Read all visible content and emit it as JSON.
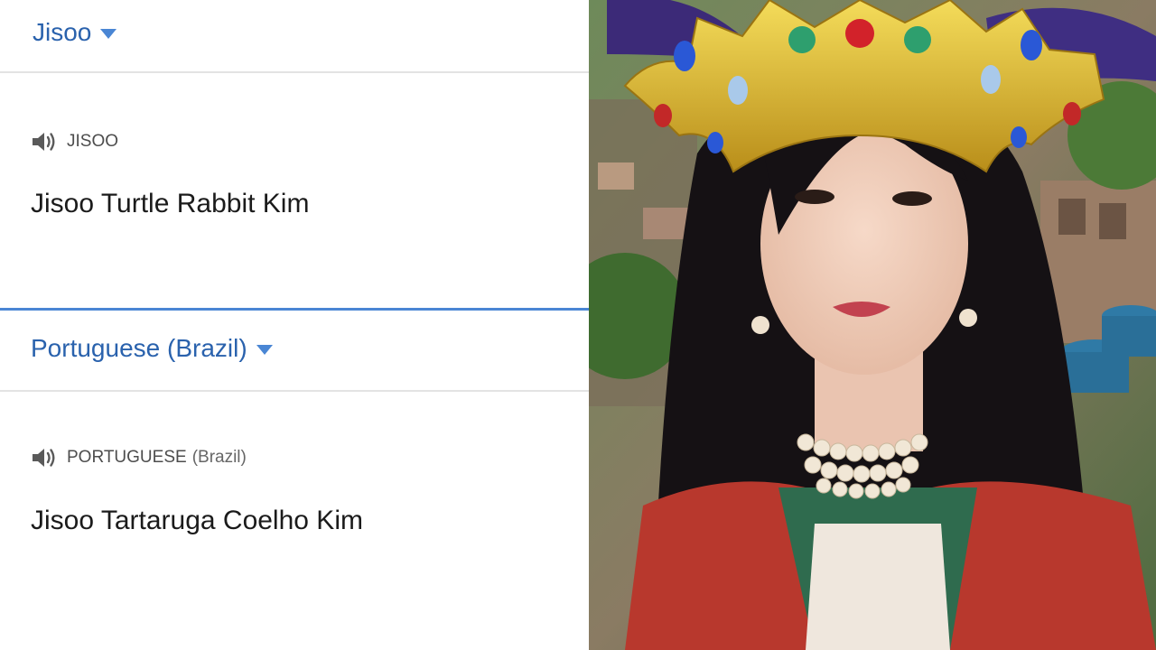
{
  "source": {
    "language_label": "Jisoo",
    "speaker_label": "JISOO",
    "text": "Jisoo Turtle Rabbit Kim"
  },
  "target": {
    "language_label": "Portuguese (Brazil)",
    "speaker_label": "PORTUGUESE",
    "speaker_sublabel": "(Brazil)",
    "text": "Jisoo Tartaruga Coelho Kim"
  },
  "colors": {
    "accent": "#4a86d4",
    "link_text": "#2a62ad",
    "divider": "#e3e3e3"
  },
  "icons": [
    "chevron-down-icon",
    "speaker-icon"
  ]
}
